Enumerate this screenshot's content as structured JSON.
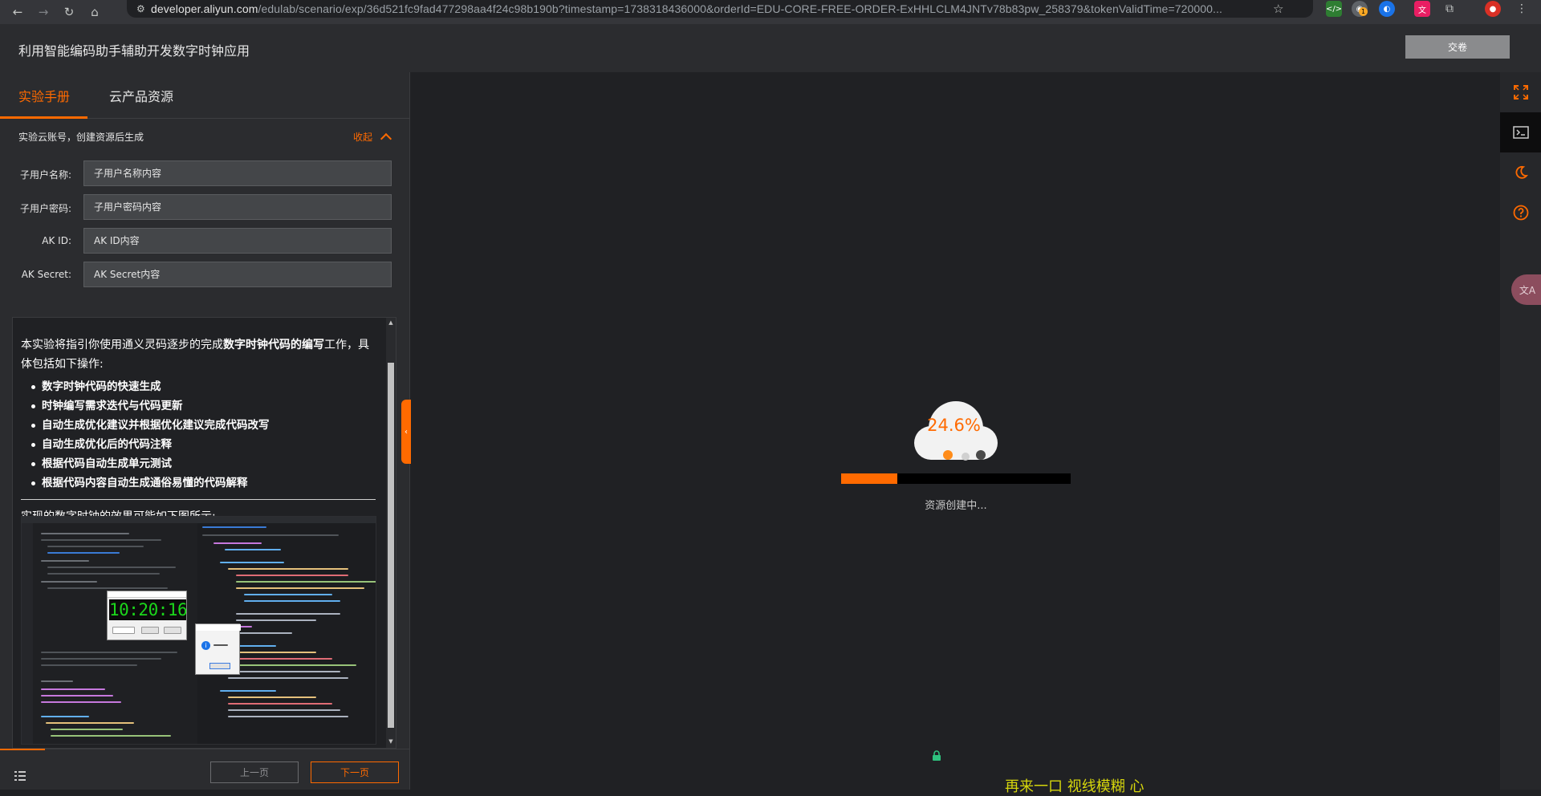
{
  "browser": {
    "url_host": "developer.aliyun.com",
    "url_rest": "/edulab/scenario/exp/36d521fc9fad477298aa4f24c98b190b?timestamp=1738318436000&orderId=EDU-CORE-FREE-ORDER-ExHHLCLM4JNTv78b83pw_258379&tokenValidTime=720000...",
    "ext_badge": "1"
  },
  "header": {
    "title": "利用智能编码助手辅助开发数字时钟应用",
    "submit_label": "交卷"
  },
  "tabs": [
    {
      "label": "实验手册"
    },
    {
      "label": "云产品资源"
    }
  ],
  "account": {
    "heading": "实验云账号，创建资源后生成",
    "collapse_label": "收起",
    "fields": [
      {
        "label": "子用户名称:",
        "value": "子用户名称内容"
      },
      {
        "label": "子用户密码:",
        "value": "子用户密码内容"
      },
      {
        "label": "AK ID:",
        "value": "AK ID内容"
      },
      {
        "label": "AK Secret:",
        "value": "AK Secret内容"
      }
    ]
  },
  "manual": {
    "intro_a": "本实验将指引你使用通义灵码逐步的完成",
    "intro_b": "数字时钟代码的编写",
    "intro_c": "工作，具体包括如下操作:",
    "tasks": [
      "数字时钟代码的快速生成",
      "时钟编写需求迭代与代码更新",
      "自动生成优化建议并根据优化建议完成代码改写",
      "自动生成优化后的代码注释",
      "根据代码自动生成单元测试",
      "根据代码内容自动生成通俗易懂的代码解释"
    ],
    "effect_text": "实现的数字时钟的效果可能如下图所示:",
    "clock_time": "10:20:16"
  },
  "footer": {
    "prev_label": "上一页",
    "next_label": "下一页"
  },
  "loading": {
    "percent_text": "24.6%",
    "progress": 0.246,
    "status": "资源创建中...",
    "bottom_text": "再来一口 视线模糊 心"
  },
  "colors": {
    "accent": "#ff6a00",
    "panel": "#2b2c2f",
    "background": "#202124"
  },
  "icons": {
    "rail": [
      "fullscreen-icon",
      "terminal-icon",
      "moon-icon",
      "help-icon"
    ],
    "translate": "translate-icon"
  }
}
